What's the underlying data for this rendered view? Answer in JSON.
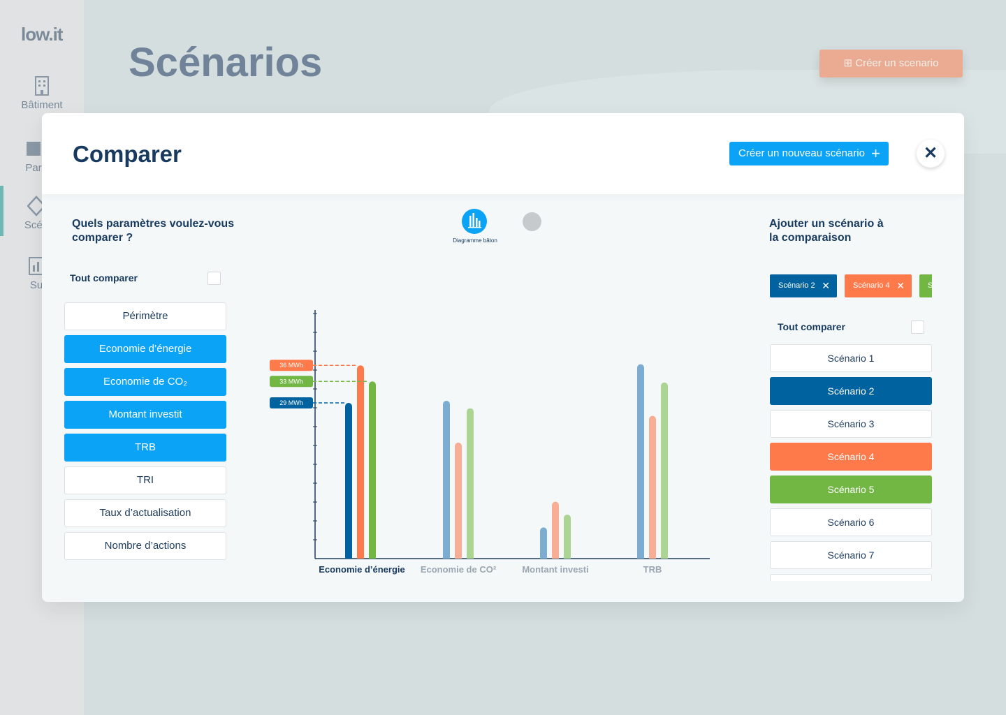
{
  "app": {
    "logo": "low.it",
    "page_title": "Scénarios",
    "create_button": "Créer un scenario",
    "sidebar": [
      {
        "label": "Bâtiment",
        "icon": "building-icon"
      },
      {
        "label": "Par",
        "icon": "calendar-icon"
      },
      {
        "label": "Scén",
        "icon": "diamond-icon"
      },
      {
        "label": "Su",
        "icon": "chart-icon"
      }
    ]
  },
  "modal": {
    "title": "Comparer",
    "new_scenario_button": "Créer un nouveau scénario",
    "close_icon": "close-icon",
    "params_title_line1": "Quels paramètres voulez-vous",
    "params_title_line2": "comparer ?",
    "compare_all": "Tout comparer",
    "params": [
      {
        "label": "Périmètre",
        "active": false
      },
      {
        "label": "Economie d’énergie",
        "active": true
      },
      {
        "label": "Economie de CO₂",
        "active": true
      },
      {
        "label": "Montant investit",
        "active": true
      },
      {
        "label": "TRB",
        "active": true
      },
      {
        "label": "TRI",
        "active": false
      },
      {
        "label": "Taux d’actualisation",
        "active": false
      },
      {
        "label": "Nombre d’actions",
        "active": false
      }
    ],
    "chart_type_label": "Diagramme bâton",
    "add_title_line1": "Ajouter un scénario à",
    "add_title_line2": "la comparaison",
    "chips": [
      {
        "label": "Scénario 2",
        "color": "#00629f"
      },
      {
        "label": "Scénario 4",
        "color": "#ff7a4a"
      },
      {
        "label": "S",
        "color": "#72b744"
      }
    ],
    "scenarios_compare_all": "Tout comparer",
    "scenarios": [
      {
        "label": "Scénario 1",
        "color": ""
      },
      {
        "label": "Scénario 2",
        "color": "#00629f"
      },
      {
        "label": "Scénario 3",
        "color": ""
      },
      {
        "label": "Scénario 4",
        "color": "#ff7a4a"
      },
      {
        "label": "Scénario 5",
        "color": "#72b744"
      },
      {
        "label": "Scénario 6",
        "color": ""
      },
      {
        "label": "Scénario 7",
        "color": ""
      }
    ]
  },
  "chart_data": {
    "type": "bar",
    "categories": [
      "Economie d’énergie",
      "Economie de CO²",
      "Montant investi",
      "TRB"
    ],
    "active_category": "Economie d’énergie",
    "series": [
      {
        "color": "#00629f",
        "values": [
          29,
          29.4,
          5.8,
          36.2
        ]
      },
      {
        "color": "#ff7a4a",
        "values": [
          36,
          21.6,
          10.6,
          26.6
        ]
      },
      {
        "color": "#72b744",
        "values": [
          33,
          28,
          8.2,
          32.8
        ]
      }
    ],
    "callouts": [
      "36 MWh",
      "33 MWh",
      "29 MWh"
    ],
    "ylim": [
      0,
      45
    ]
  }
}
